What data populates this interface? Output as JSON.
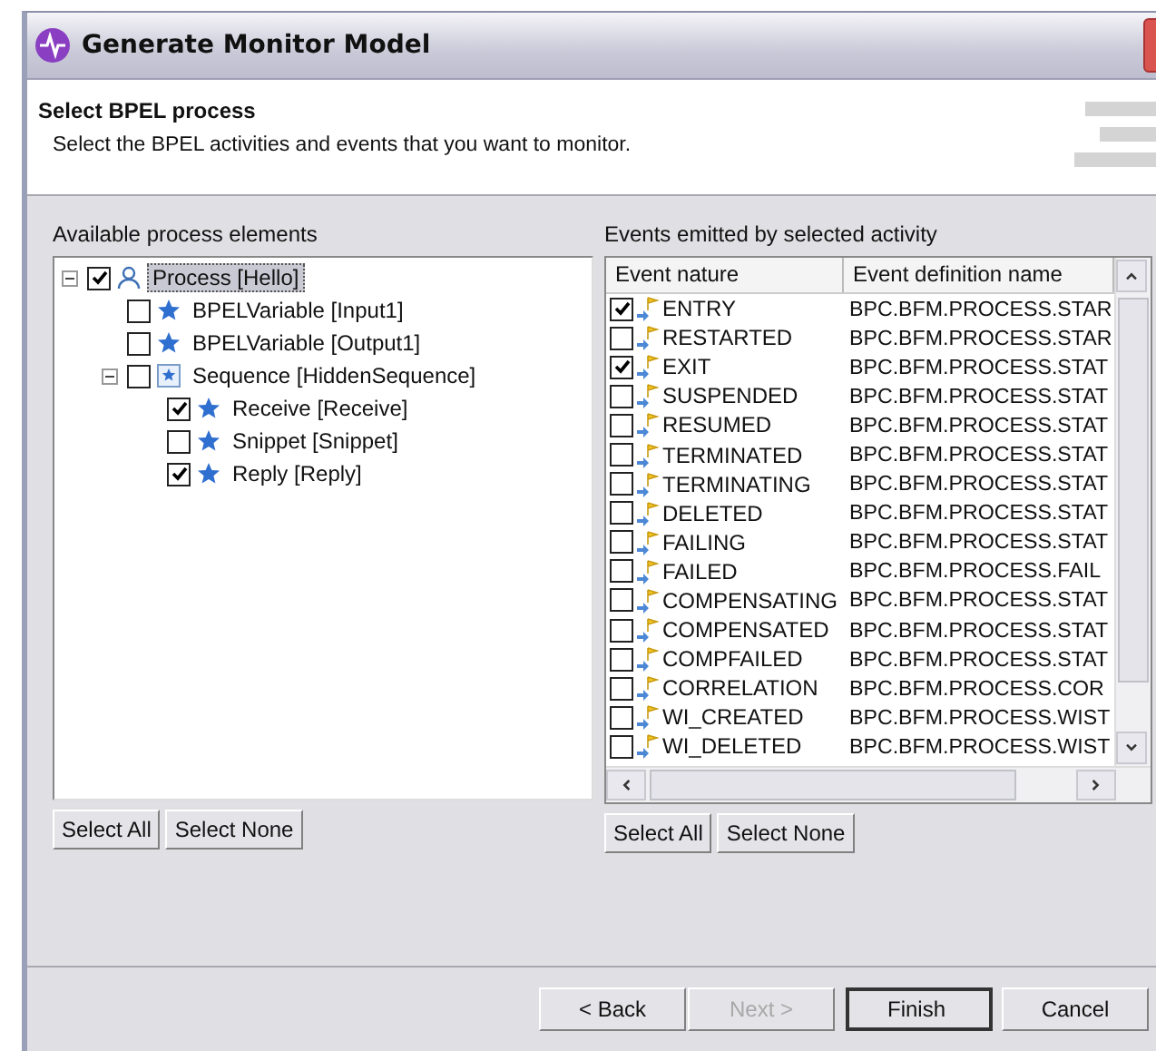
{
  "window": {
    "title": "Generate Monitor Model"
  },
  "header": {
    "title": "Select BPEL process",
    "description": "Select the BPEL activities and events that you want to monitor."
  },
  "elements": {
    "label": "Available process elements",
    "tree": [
      {
        "label": "Process  [Hello]",
        "kind": "process",
        "checked": true,
        "selected": true,
        "expanded": true,
        "children": [
          {
            "label": "BPELVariable [Input1]",
            "kind": "star",
            "checked": false,
            "selected": false
          },
          {
            "label": "BPELVariable [Output1]",
            "kind": "star",
            "checked": false,
            "selected": false
          },
          {
            "label": "Sequence  [HiddenSequence]",
            "kind": "sequence",
            "checked": false,
            "selected": false,
            "expanded": true,
            "children": [
              {
                "label": "Receive  [Receive]",
                "kind": "star",
                "checked": true,
                "selected": false
              },
              {
                "label": "Snippet  [Snippet]",
                "kind": "star",
                "checked": false,
                "selected": false
              },
              {
                "label": "Reply  [Reply]",
                "kind": "star",
                "checked": true,
                "selected": false
              }
            ]
          }
        ]
      }
    ],
    "buttons": [
      "Select All",
      "Select None"
    ]
  },
  "events": {
    "label": "Events emitted by selected activity",
    "columns": [
      "Event nature",
      "Event definition name"
    ],
    "rows": [
      {
        "nature": "ENTRY",
        "definition": "BPC.BFM.PROCESS.STAR",
        "checked": true
      },
      {
        "nature": "RESTARTED",
        "definition": "BPC.BFM.PROCESS.STAR",
        "checked": false
      },
      {
        "nature": "EXIT",
        "definition": "BPC.BFM.PROCESS.STAT",
        "checked": true
      },
      {
        "nature": "SUSPENDED",
        "definition": "BPC.BFM.PROCESS.STAT",
        "checked": false
      },
      {
        "nature": "RESUMED",
        "definition": "BPC.BFM.PROCESS.STAT",
        "checked": false
      },
      {
        "nature": "TERMINATED",
        "definition": "BPC.BFM.PROCESS.STAT",
        "checked": false
      },
      {
        "nature": "TERMINATING",
        "definition": "BPC.BFM.PROCESS.STAT",
        "checked": false
      },
      {
        "nature": "DELETED",
        "definition": "BPC.BFM.PROCESS.STAT",
        "checked": false
      },
      {
        "nature": "FAILING",
        "definition": "BPC.BFM.PROCESS.STAT",
        "checked": false
      },
      {
        "nature": "FAILED",
        "definition": "BPC.BFM.PROCESS.FAIL",
        "checked": false
      },
      {
        "nature": "COMPENSATING",
        "definition": "BPC.BFM.PROCESS.STAT",
        "checked": false
      },
      {
        "nature": "COMPENSATED",
        "definition": "BPC.BFM.PROCESS.STAT",
        "checked": false
      },
      {
        "nature": "COMPFAILED",
        "definition": "BPC.BFM.PROCESS.STAT",
        "checked": false
      },
      {
        "nature": "CORRELATION",
        "definition": "BPC.BFM.PROCESS.COR",
        "checked": false
      },
      {
        "nature": "WI_CREATED",
        "definition": "BPC.BFM.PROCESS.WIST",
        "checked": false
      },
      {
        "nature": "WI_DELETED",
        "definition": "BPC.BFM.PROCESS.WIST",
        "checked": false
      }
    ],
    "buttons": [
      "Select All",
      "Select None"
    ]
  },
  "footer": {
    "buttons": [
      {
        "label": "< Back",
        "disabled": false,
        "default": false
      },
      {
        "label": "Next >",
        "disabled": true,
        "default": false
      },
      {
        "label": "Finish",
        "disabled": false,
        "default": true
      },
      {
        "label": "Cancel",
        "disabled": false,
        "default": false
      }
    ]
  }
}
